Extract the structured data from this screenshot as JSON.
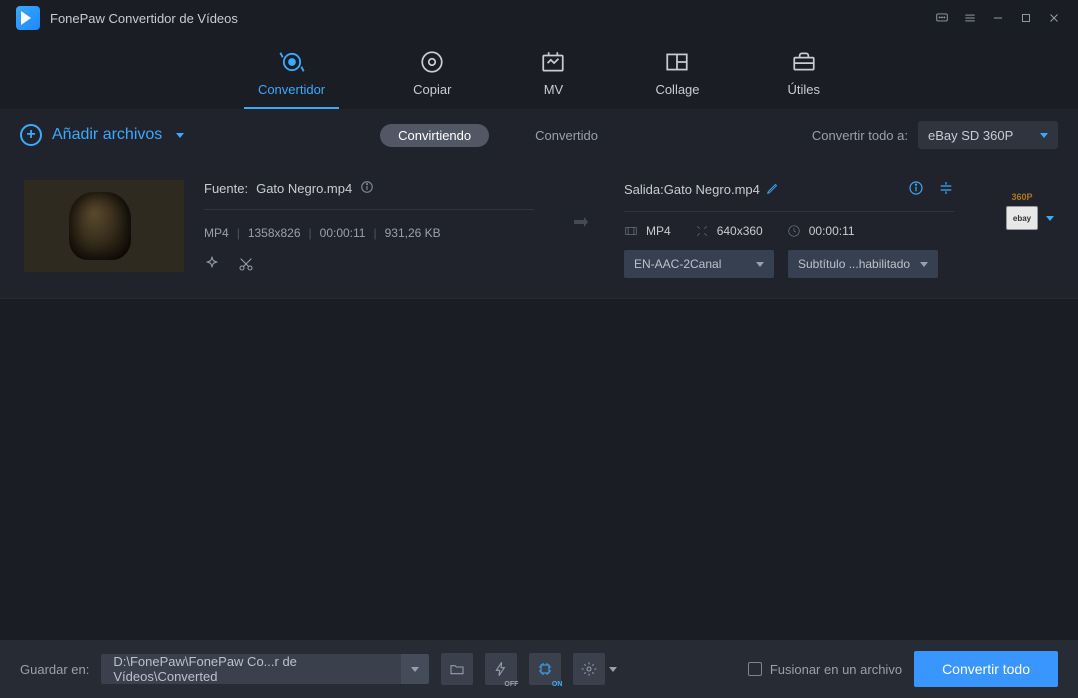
{
  "app": {
    "title": "FonePaw Convertidor de Vídeos"
  },
  "nav": {
    "converter": "Convertidor",
    "copy": "Copiar",
    "mv": "MV",
    "collage": "Collage",
    "tools": "Útiles"
  },
  "subbar": {
    "add_files": "Añadir archivos",
    "converting": "Convirtiendo",
    "converted": "Convertido",
    "convert_all_to": "Convertir todo a:",
    "profile": "eBay SD 360P"
  },
  "item": {
    "source_label": "Fuente:",
    "source_name": "Gato Negro.mp4",
    "format": "MP4",
    "src_res": "1358x826",
    "src_dur": "00:00:11",
    "src_size": "931,26 KB",
    "output_label": "Salida:",
    "output_name": "Gato Negro.mp4",
    "out_format": "MP4",
    "out_res": "640x360",
    "out_dur": "00:00:11",
    "audio_sel": "EN-AAC-2Canal",
    "sub_sel": "Subtítulo ...habilitado",
    "profile_res": "360P",
    "profile_brand": "ebay"
  },
  "footer": {
    "save_to": "Guardar en:",
    "path": "D:\\FonePaw\\FonePaw Co...r de Vídeos\\Converted",
    "merge": "Fusionar en un archivo",
    "convert_all": "Convertir todo"
  }
}
